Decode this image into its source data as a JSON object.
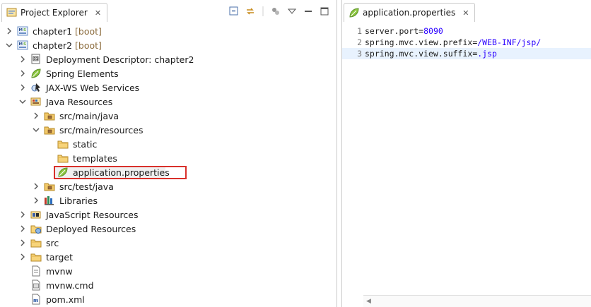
{
  "explorer": {
    "title": "Project Explorer",
    "close": "✕",
    "tree": [
      {
        "label": "chapter1",
        "deco": " [boot]",
        "level": 0,
        "arrow": "right",
        "icon": "project-icon",
        "name": "tree-item-chapter1"
      },
      {
        "label": "chapter2",
        "deco": " [boot]",
        "level": 0,
        "arrow": "down",
        "icon": "project-icon",
        "name": "tree-item-chapter2"
      },
      {
        "label": "Deployment Descriptor: chapter2",
        "deco": "",
        "level": 1,
        "arrow": "right",
        "icon": "descriptor-icon",
        "name": "tree-item-deployment-descriptor"
      },
      {
        "label": "Spring Elements",
        "deco": "",
        "level": 1,
        "arrow": "right",
        "icon": "spring-leaf-icon",
        "name": "tree-item-spring-elements"
      },
      {
        "label": "JAX-WS Web Services",
        "deco": "",
        "level": 1,
        "arrow": "right",
        "icon": "webservices-icon",
        "name": "tree-item-jaxws"
      },
      {
        "label": "Java Resources",
        "deco": "",
        "level": 1,
        "arrow": "down",
        "icon": "java-resources-icon",
        "name": "tree-item-java-resources"
      },
      {
        "label": "src/main/java",
        "deco": "",
        "level": 2,
        "arrow": "right",
        "icon": "package-folder-icon",
        "name": "tree-item-src-main-java"
      },
      {
        "label": "src/main/resources",
        "deco": "",
        "level": 2,
        "arrow": "down",
        "icon": "package-folder-icon",
        "name": "tree-item-src-main-resources"
      },
      {
        "label": "static",
        "deco": "",
        "level": 3,
        "arrow": "none",
        "icon": "folder-icon",
        "name": "tree-item-static"
      },
      {
        "label": "templates",
        "deco": "",
        "level": 3,
        "arrow": "none",
        "icon": "folder-icon",
        "name": "tree-item-templates"
      },
      {
        "label": "application.properties",
        "deco": "",
        "level": 3,
        "arrow": "none",
        "icon": "spring-leaf-icon",
        "name": "tree-item-application-properties"
      },
      {
        "label": "src/test/java",
        "deco": "",
        "level": 2,
        "arrow": "right",
        "icon": "package-folder-icon",
        "name": "tree-item-src-test-java"
      },
      {
        "label": "Libraries",
        "deco": "",
        "level": 2,
        "arrow": "right",
        "icon": "library-icon",
        "name": "tree-item-libraries"
      },
      {
        "label": "JavaScript Resources",
        "deco": "",
        "level": 1,
        "arrow": "right",
        "icon": "js-resources-icon",
        "name": "tree-item-javascript-resources"
      },
      {
        "label": "Deployed Resources",
        "deco": "",
        "level": 1,
        "arrow": "right",
        "icon": "deployed-icon",
        "name": "tree-item-deployed-resources"
      },
      {
        "label": "src",
        "deco": "",
        "level": 1,
        "arrow": "right",
        "icon": "folder-icon",
        "name": "tree-item-src"
      },
      {
        "label": "target",
        "deco": "",
        "level": 1,
        "arrow": "right",
        "icon": "folder-icon",
        "name": "tree-item-target"
      },
      {
        "label": "mvnw",
        "deco": "",
        "level": 1,
        "arrow": "none",
        "icon": "file-icon",
        "name": "tree-item-mvnw"
      },
      {
        "label": "mvnw.cmd",
        "deco": "",
        "level": 1,
        "arrow": "none",
        "icon": "cmd-file-icon",
        "name": "tree-item-mvnw-cmd"
      },
      {
        "label": "pom.xml",
        "deco": "",
        "level": 1,
        "arrow": "none",
        "icon": "xml-file-icon",
        "name": "tree-item-pom-xml"
      }
    ]
  },
  "editor": {
    "title": "application.properties",
    "close": "✕",
    "lines": [
      {
        "num": "1",
        "key": "server.port=",
        "val": "8090"
      },
      {
        "num": "2",
        "key": "spring.mvc.view.prefix=",
        "val": "/WEB-INF/jsp/"
      },
      {
        "num": "3",
        "key": "spring.mvc.view.suffix=",
        "val": ".jsp"
      }
    ]
  },
  "colors": {
    "highlight_border": "#d9302b",
    "value_text": "#2a00ff",
    "folder": "#e8b84a",
    "spring": "#6db33f"
  }
}
